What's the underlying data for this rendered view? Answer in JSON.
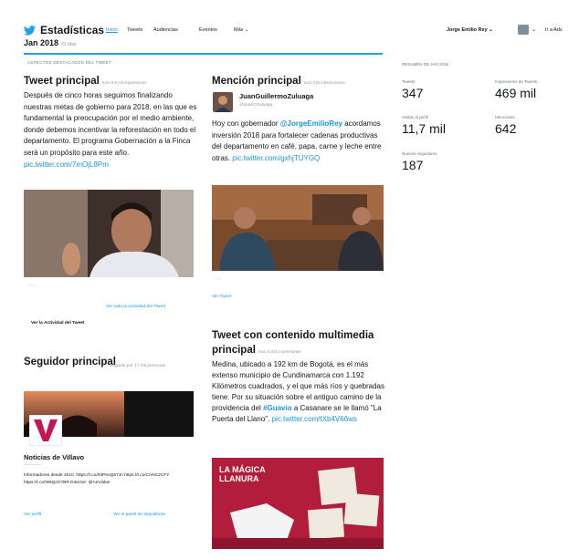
{
  "app": {
    "title": "Estadísticas"
  },
  "nav": {
    "home": "Inicio",
    "tweets": "Tweets",
    "audiences": "Audiencias",
    "events": "Eventos",
    "more": "Más"
  },
  "user": {
    "name": "Jorge Emilio Rey",
    "goto_ads": "Ir a Ads"
  },
  "period": {
    "label": "Jan 2018",
    "days": "31 días"
  },
  "highlights_label": "ASPECTOS DESTACADOS DEL TWEET",
  "top_tweet": {
    "title": "Tweet principal",
    "impressions": "tuvo 8.8 mil impresiones",
    "text": "Después de cinco horas seguimos finalizando nuestras metas de gobierno para 2018, en las que es fundamental la preocupación por el medio ambiente, donde debemos incentivar la reforestación en todo el departamento. El programa Gobernación a la Finca será un propósito para este año.",
    "link": "pic.twitter.com/7mOjL8Pm",
    "activity_link": "Ver toda la actividad del Tweet",
    "activity_bold": "Ver la Actividad del Tweet"
  },
  "top_mention": {
    "title": "Mención principal",
    "interactions": "tuvo 216 interacciones",
    "author": "JuanGuillermoZuluaga",
    "author_handle": "@JuanGZuluaga",
    "text_pre": "Hoy con gobernador ",
    "mention": "@JorgeEmilioRey",
    "text_post": " acordamos inversión 2018 para fortalecer cadenas productivas del departamento en café, papa, carne y leche entre otras.",
    "link": "pic.twitter.com/gxhjTUYGQ",
    "view_tweet": "Ver Tweet"
  },
  "top_follower": {
    "title": "Seguidor principal",
    "followed_by": "Seguido por 17 mil personas",
    "name": "Noticias de Villavo",
    "bio": "Informadores desde 2010. https://t.co/34PeoQ57Jn https://t.co/CANC2CFY https://t.co/W6QzG7BR Director: @Arnoldus",
    "profile_link": "Ver perfil",
    "view_followers": "Ver el panel de seguidores"
  },
  "media_tweet": {
    "title": "Tweet con contenido multimedia principal",
    "impressions": "tuvo 5.815 impresiones",
    "text_pre": "Medina, ubicado a 192 km de Bogotá, es el más extenso municipio de Cundinamarca con 1.192 Kilómetros cuadrados, y el que más ríos y quebradas tiene. Por su situación sobre el antiguo camino de la providencia del ",
    "hashtag": "#Guavio",
    "text_post": " a Casanare se le llamó \"La Puerta del Llano\".",
    "link": "pic.twitter.com/tXb4V66ws",
    "image_banner": "LA MÁGICA LLANURA"
  },
  "summary": {
    "title": "RESUMEN DE JAN 2018",
    "stats": [
      {
        "label": "Tweets",
        "value": "347"
      },
      {
        "label": "Impresiones de Tweets",
        "value": "469 mil"
      },
      {
        "label": "Visitas al perfil",
        "value": "11,7 mil"
      },
      {
        "label": "Menciones",
        "value": "642"
      },
      {
        "label": "Nuevos seguidores",
        "value": "187"
      }
    ]
  },
  "colors": {
    "accent": "#1da1f2",
    "link": "#1b95e0"
  }
}
